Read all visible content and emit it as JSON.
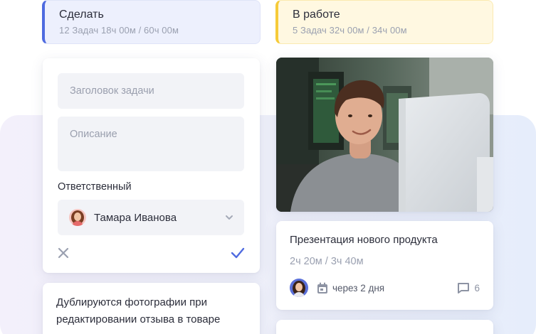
{
  "columns": {
    "todo": {
      "title": "Сделать",
      "meta": "12 Задач  18ч 00м / 60ч 00м",
      "accent": "#4f6be0"
    },
    "in_progress": {
      "title": "В работе",
      "meta": "5 Задач  32ч 00м / 34ч 00м",
      "accent": "#f6cb39"
    }
  },
  "new_task_form": {
    "title_placeholder": "Заголовок задачи",
    "description_placeholder": "Описание",
    "assignee_label": "Ответственный",
    "assignee_value": "Тамара Иванова",
    "icons": {
      "cancel": "close-icon",
      "confirm": "check-icon",
      "dropdown": "chevron-down-icon"
    }
  },
  "tasks": [
    {
      "title": "Презентация нового продукта",
      "time": "2ч 20м / 3ч 40м",
      "due": "через 2 дня",
      "comments": "6"
    }
  ],
  "todo_tasks": [
    {
      "title": "Дублируются фотографии при редактировании отзыва в товаре"
    }
  ],
  "colors": {
    "accent_blue": "#4f6be0",
    "accent_yellow": "#f6cb39"
  }
}
